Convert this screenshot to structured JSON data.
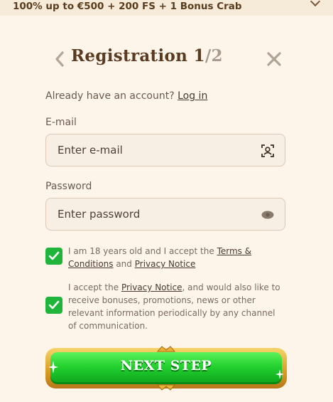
{
  "banner": {
    "text": "100% up to €500 + 200 FS + 1 Bonus Crab"
  },
  "header": {
    "title": "Registration",
    "step_current": "1",
    "step_total": "/2"
  },
  "login": {
    "prompt": "Already have an account?",
    "link": "Log in"
  },
  "email": {
    "label": "E-mail",
    "placeholder": "Enter e-mail",
    "icon": "contact-scan-icon"
  },
  "password": {
    "label": "Password",
    "placeholder": "Enter password",
    "icon": "eye-icon"
  },
  "consents": [
    {
      "checked": true,
      "text_before": "I am 18 years old and I accept the ",
      "link1": "Terms & Conditions",
      "text_middle": " and ",
      "link2": "Privacy Notice"
    },
    {
      "checked": true,
      "text_before": "I accept the ",
      "link": "Privacy Notice",
      "text_after": ", and would also like to receive bonuses, promotions, news or other relevant information periodically by any channel of communication."
    }
  ],
  "cta": {
    "label": "NEXT STEP"
  },
  "colors": {
    "accent_green": "#1fb53a",
    "title_brown": "#5a3a20",
    "gold": "#e0a82e"
  }
}
